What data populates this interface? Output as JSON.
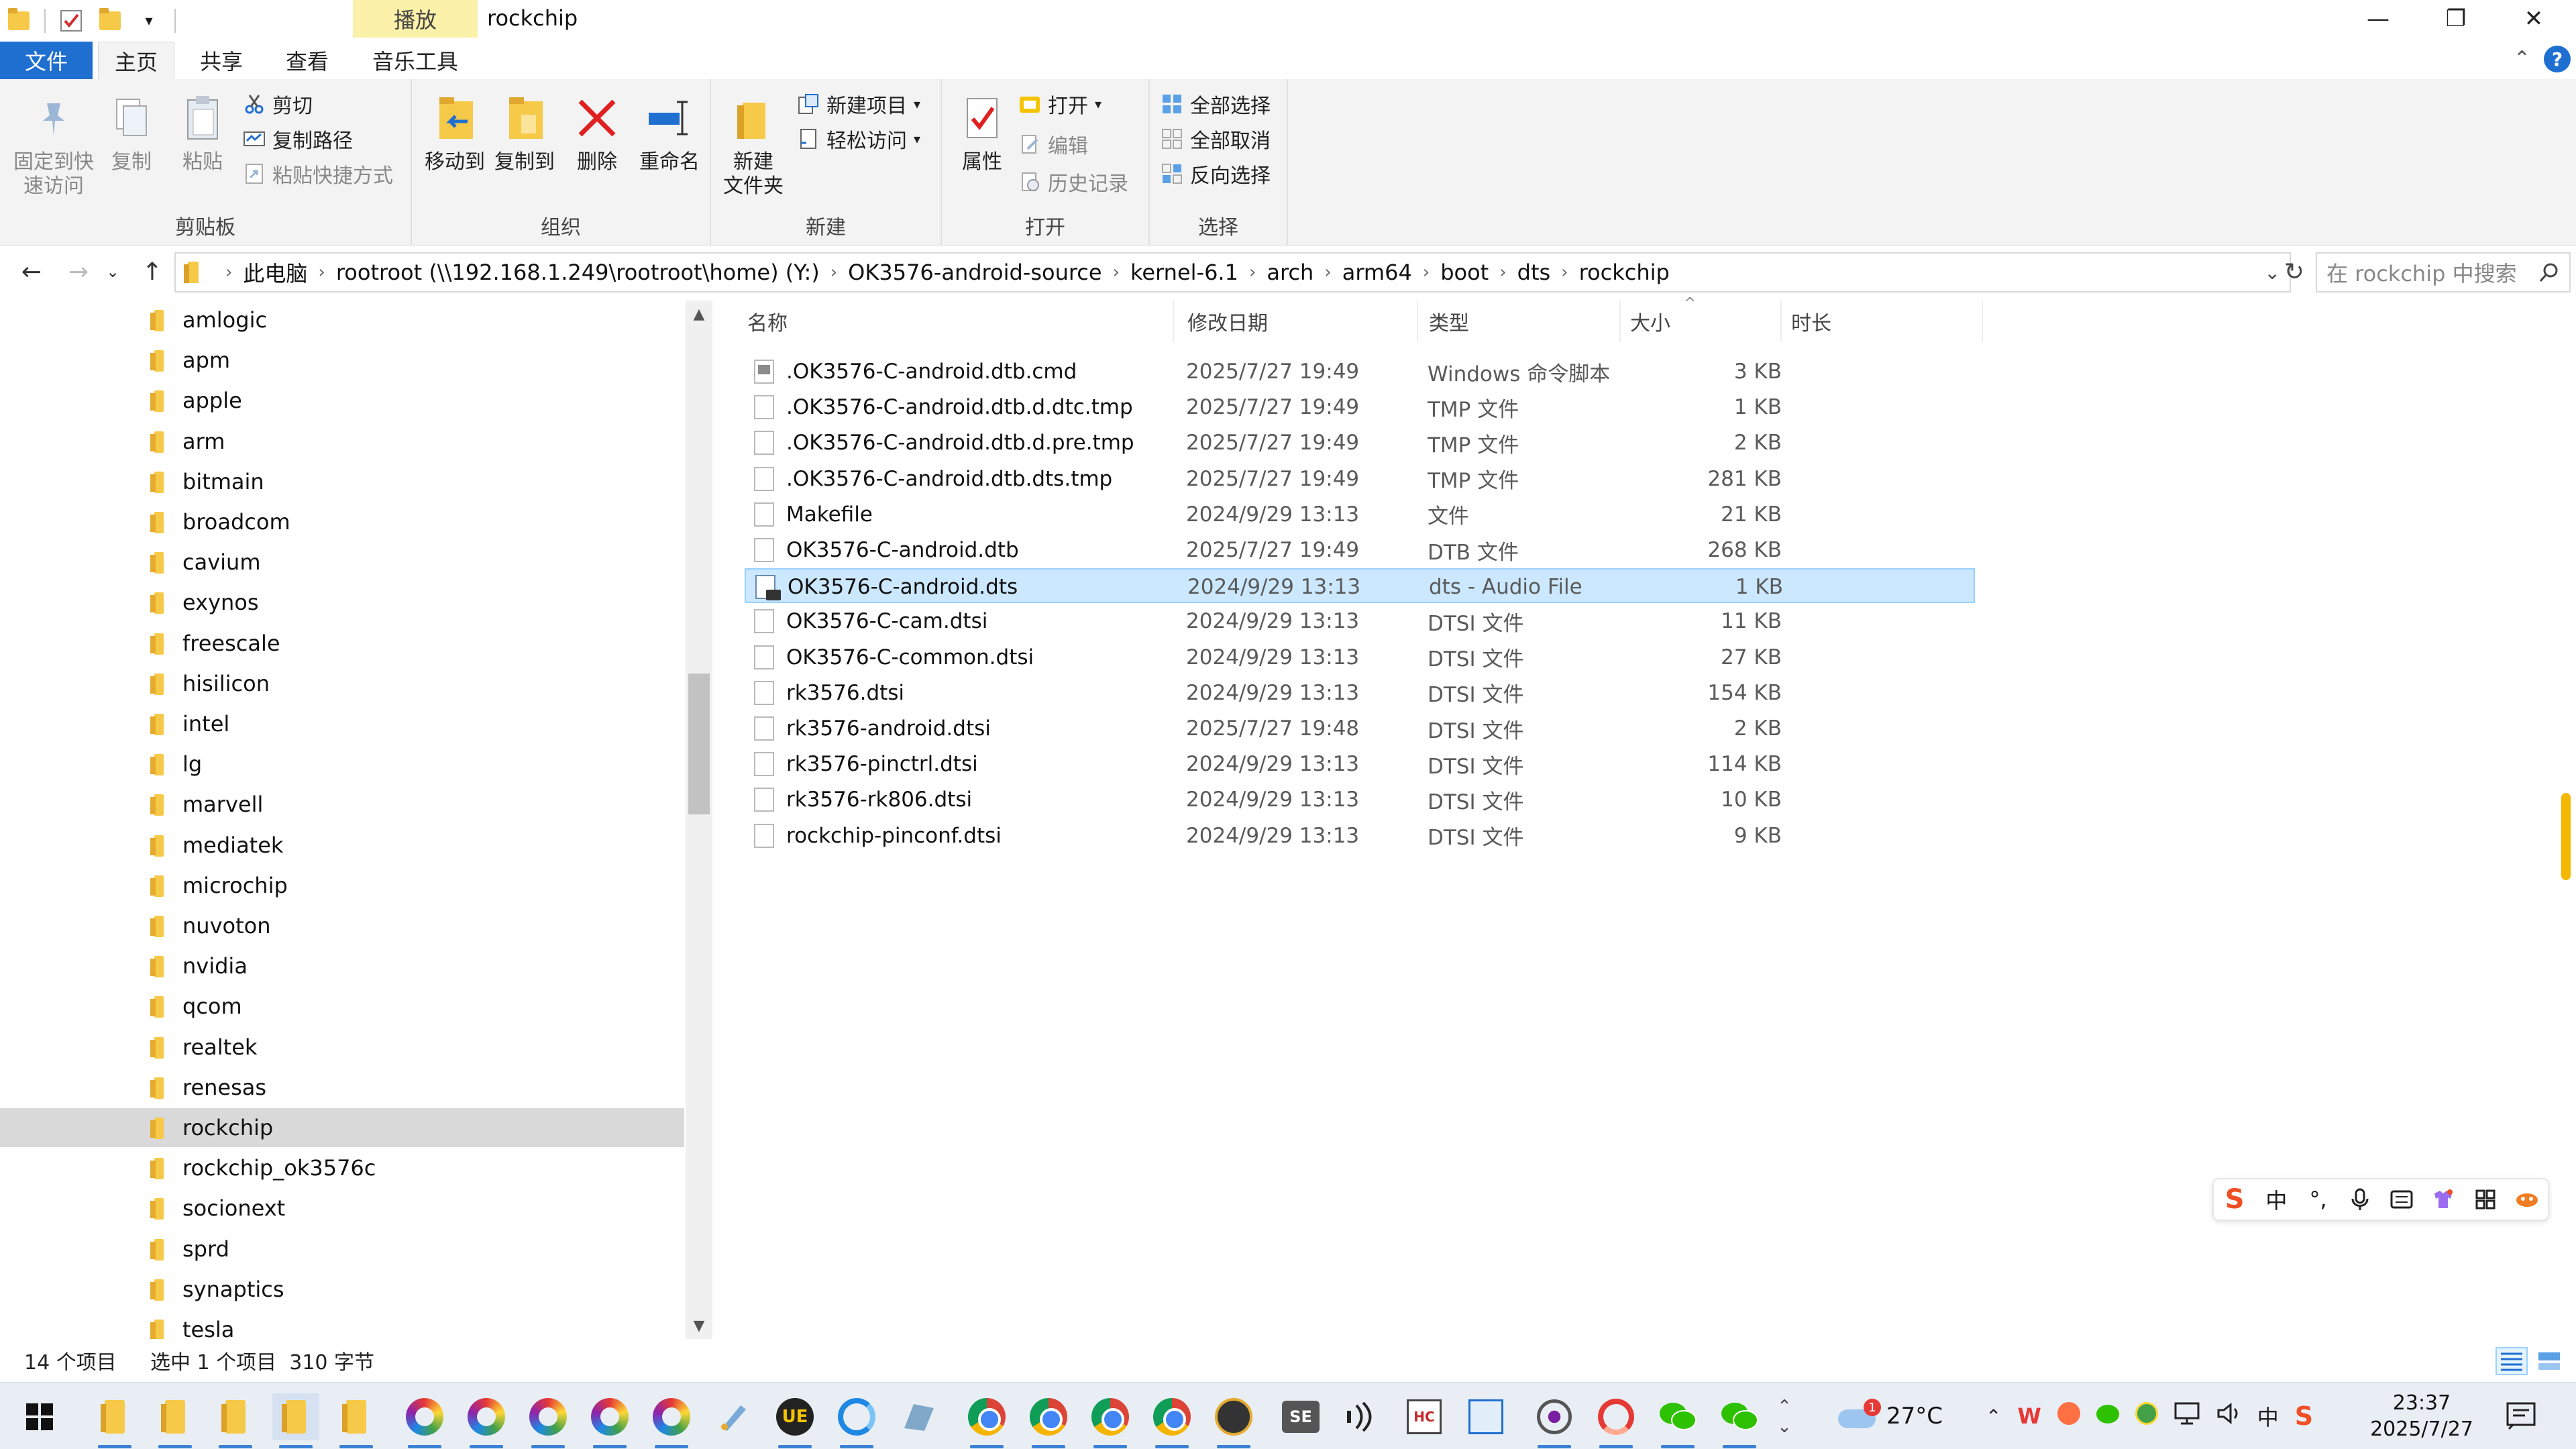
{
  "window": {
    "title": "rockchip",
    "context_tab": "播放",
    "controls": {
      "minimize": "—",
      "restore": "❐",
      "close": "✕"
    }
  },
  "ribbon_tabs": [
    {
      "label": "文件"
    },
    {
      "label": "主页"
    },
    {
      "label": "共享"
    },
    {
      "label": "查看"
    },
    {
      "label": "音乐工具"
    }
  ],
  "ribbon": {
    "clipboard": {
      "label": "剪贴板",
      "pin": "固定到快\n速访问",
      "copy": "复制",
      "paste": "粘贴",
      "cut": "剪切",
      "copy_path": "复制路径",
      "paste_shortcut": "粘贴快捷方式"
    },
    "organize": {
      "label": "组织",
      "move_to": "移动到",
      "copy_to": "复制到",
      "delete": "删除",
      "rename": "重命名"
    },
    "new": {
      "label": "新建",
      "new_folder": "新建\n文件夹",
      "new_item": "新建项目",
      "easy_access": "轻松访问"
    },
    "open": {
      "label": "打开",
      "properties": "属性",
      "open": "打开",
      "edit": "编辑",
      "history": "历史记录"
    },
    "select": {
      "label": "选择",
      "select_all": "全部选择",
      "select_none": "全部取消",
      "invert": "反向选择"
    }
  },
  "address": {
    "crumbs": [
      "此电脑",
      "rootroot (\\\\192.168.1.249\\rootroot\\home) (Y:)",
      "OK3576-android-source",
      "kernel-6.1",
      "arch",
      "arm64",
      "boot",
      "dts",
      "rockchip"
    ],
    "search_placeholder": "在 rockchip 中搜索"
  },
  "nav_items": [
    "amlogic",
    "apm",
    "apple",
    "arm",
    "bitmain",
    "broadcom",
    "cavium",
    "exynos",
    "freescale",
    "hisilicon",
    "intel",
    "lg",
    "marvell",
    "mediatek",
    "microchip",
    "nuvoton",
    "nvidia",
    "qcom",
    "realtek",
    "renesas",
    "rockchip",
    "rockchip_ok3576c",
    "socionext",
    "sprd",
    "synaptics",
    "tesla"
  ],
  "nav_selected": "rockchip",
  "columns": {
    "name": "名称",
    "date": "修改日期",
    "type": "类型",
    "size": "大小",
    "duration": "时长"
  },
  "files": [
    {
      "name": ".OK3576-C-android.dtb.cmd",
      "date": "2025/7/27 19:49",
      "type": "Windows 命令脚本",
      "size": "3 KB",
      "icon": "cmd-file-icon"
    },
    {
      "name": ".OK3576-C-android.dtb.d.dtc.tmp",
      "date": "2025/7/27 19:49",
      "type": "TMP 文件",
      "size": "1 KB",
      "icon": "file-icon"
    },
    {
      "name": ".OK3576-C-android.dtb.d.pre.tmp",
      "date": "2025/7/27 19:49",
      "type": "TMP 文件",
      "size": "2 KB",
      "icon": "file-icon"
    },
    {
      "name": ".OK3576-C-android.dtb.dts.tmp",
      "date": "2025/7/27 19:49",
      "type": "TMP 文件",
      "size": "281 KB",
      "icon": "file-icon"
    },
    {
      "name": "Makefile",
      "date": "2024/9/29 13:13",
      "type": "文件",
      "size": "21 KB",
      "icon": "file-icon"
    },
    {
      "name": "OK3576-C-android.dtb",
      "date": "2025/7/27 19:49",
      "type": "DTB 文件",
      "size": "268 KB",
      "icon": "file-icon"
    },
    {
      "name": "OK3576-C-android.dts",
      "date": "2024/9/29 13:13",
      "type": "dts - Audio File",
      "size": "1 KB",
      "icon": "audio-file-icon",
      "selected": true
    },
    {
      "name": "OK3576-C-cam.dtsi",
      "date": "2024/9/29 13:13",
      "type": "DTSI 文件",
      "size": "11 KB",
      "icon": "file-icon"
    },
    {
      "name": "OK3576-C-common.dtsi",
      "date": "2024/9/29 13:13",
      "type": "DTSI 文件",
      "size": "27 KB",
      "icon": "file-icon"
    },
    {
      "name": "rk3576.dtsi",
      "date": "2024/9/29 13:13",
      "type": "DTSI 文件",
      "size": "154 KB",
      "icon": "file-icon"
    },
    {
      "name": "rk3576-android.dtsi",
      "date": "2025/7/27 19:48",
      "type": "DTSI 文件",
      "size": "2 KB",
      "icon": "file-icon"
    },
    {
      "name": "rk3576-pinctrl.dtsi",
      "date": "2024/9/29 13:13",
      "type": "DTSI 文件",
      "size": "114 KB",
      "icon": "file-icon"
    },
    {
      "name": "rk3576-rk806.dtsi",
      "date": "2024/9/29 13:13",
      "type": "DTSI 文件",
      "size": "10 KB",
      "icon": "file-icon"
    },
    {
      "name": "rockchip-pinconf.dtsi",
      "date": "2024/9/29 13:13",
      "type": "DTSI 文件",
      "size": "9 KB",
      "icon": "file-icon"
    }
  ],
  "status": {
    "count": "14 个项目",
    "selection": "选中 1 个项目  310 字节"
  },
  "ime": {
    "mode": "中"
  },
  "taskbar": {
    "weather": "27°C",
    "weather_badge": "1",
    "tray_ime": "中",
    "time": "23:37",
    "date": "2025/7/27"
  },
  "colors": {
    "accent": "#1f6fd1",
    "selection": "#cce8ff",
    "selection_border": "#99d1ff",
    "context_tab": "#fcf1a8"
  }
}
